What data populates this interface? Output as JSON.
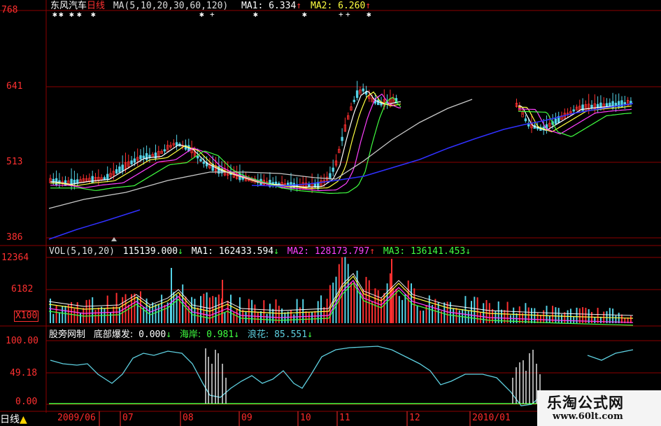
{
  "price_panel": {
    "stock_name": "东风汽车",
    "period": "日线",
    "ma_params": "MA(5,10,20,30,60,120)",
    "ma1_label": "MA1:",
    "ma1_value": "6.334",
    "ma1_arrow": "↑",
    "ma2_label": "MA2:",
    "ma2_value": "6.260",
    "ma2_arrow": "↑",
    "y_labels": [
      "768",
      "641",
      "513",
      "386"
    ]
  },
  "volume_panel": {
    "indicator": "VOL(5,10,20)",
    "value": "115139.000",
    "value_arrow": "↓",
    "ma1_label": "MA1:",
    "ma1_value": "162433.594",
    "ma1_arrow": "↓",
    "ma2_label": "MA2:",
    "ma2_value": "128173.797",
    "ma2_arrow": "↑",
    "ma3_label": "MA3:",
    "ma3_value": "136141.453",
    "ma3_arrow": "↓",
    "y_labels": [
      "12364",
      "6182"
    ],
    "unit_label": "X100"
  },
  "indicator_panel": {
    "name": "股旁网制",
    "line1_label": "底部爆发:",
    "line1_value": "0.000",
    "line1_arrow": "↓",
    "line2_label": "海岸:",
    "line2_value": "0.981",
    "line2_arrow": "↓",
    "line3_label": "浪花:",
    "line3_value": "85.551",
    "line3_arrow": "↓",
    "y_labels": [
      "100.00",
      "49.18",
      "0.00"
    ]
  },
  "date_axis": {
    "labels": [
      "2009/06",
      "07",
      "08",
      "09",
      "10",
      "11",
      "12",
      "2010/01"
    ]
  },
  "footer": {
    "period_tab": "日线"
  },
  "watermark": {
    "title": "乐淘公式网",
    "url": "www.60lt.com"
  },
  "colors": {
    "background": "#000000",
    "grid": "#8b0000",
    "axis_text": "#ff3030",
    "up_candle": "#ff3030",
    "down_candle": "#54d2e6",
    "ma_white": "#ffffff",
    "ma_yellow": "#ffff40",
    "ma_magenta": "#ff40ff",
    "ma_green": "#40ff40",
    "ma_gray": "#c8c8c8",
    "ma_blue": "#3030ff",
    "sea_line": "#5ed0e0"
  }
}
